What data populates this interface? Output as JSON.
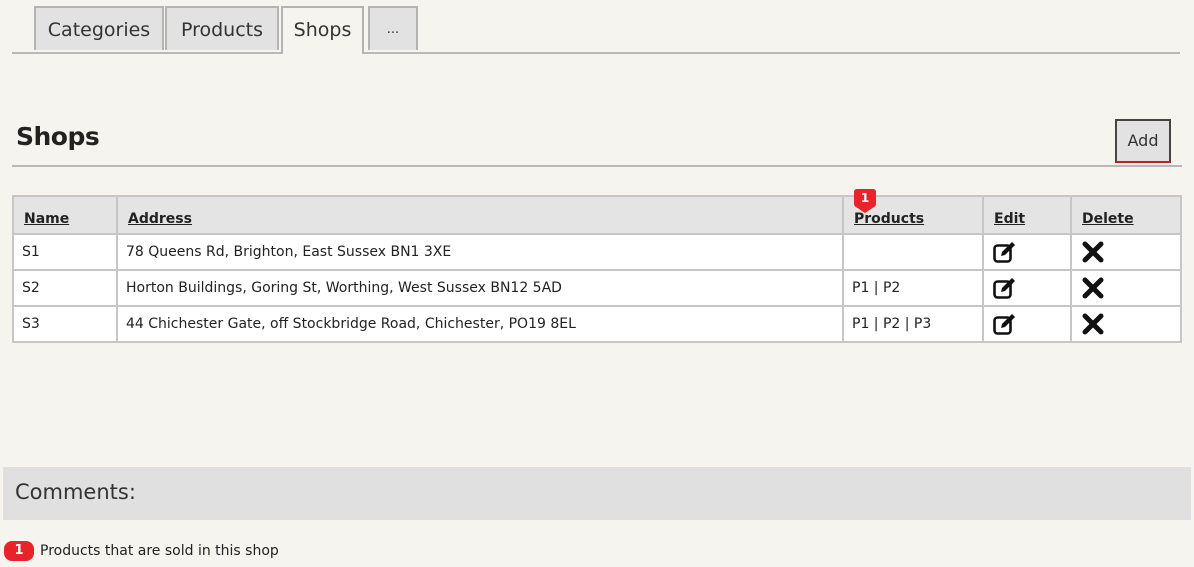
{
  "tabs": [
    {
      "label": "Categories",
      "active": false
    },
    {
      "label": "Products",
      "active": false
    },
    {
      "label": "Shops",
      "active": true
    },
    {
      "label": "...",
      "active": false
    }
  ],
  "page": {
    "title": "Shops",
    "add_label": "Add"
  },
  "table": {
    "headers": {
      "name": "Name",
      "address": "Address",
      "products": "Products",
      "edit": "Edit",
      "delete": "Delete"
    },
    "products_marker": "1",
    "rows": [
      {
        "name": "S1",
        "address": "78 Queens Rd, Brighton, East Sussex BN1 3XE",
        "products": ""
      },
      {
        "name": "S2",
        "address": "Horton Buildings, Goring St, Worthing, West Sussex BN12 5AD",
        "products": "P1 | P2"
      },
      {
        "name": "S3",
        "address": "44 Chichester Gate, off Stockbridge Road, Chichester, PO19 8EL",
        "products": "P1 | P2 | P3"
      }
    ],
    "icons": {
      "edit": "edit-icon",
      "delete": "delete-icon"
    }
  },
  "comments": {
    "title": "Comments:",
    "items": [
      {
        "number": "1",
        "text": "Products that are sold in this shop"
      }
    ]
  },
  "colors": {
    "marker": "#e8242a",
    "add_underline": "#c42020"
  }
}
